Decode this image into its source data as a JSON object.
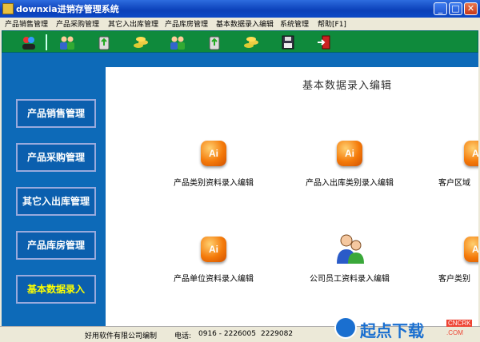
{
  "window": {
    "title": "downxia进销存管理系统"
  },
  "menu": [
    "产品销售管理",
    "产品采购管理",
    "其它入出库管理",
    "产品库房管理",
    "基本数据录入编辑",
    "系统管理",
    "帮助[F1]"
  ],
  "toolbar_icons": [
    "users-icon",
    "group-icon",
    "recycle-bin-icon",
    "coins-icon",
    "group-icon",
    "recycle-bin-icon",
    "coins-icon",
    "disk-icon",
    "exit-door-icon"
  ],
  "sidebar": [
    {
      "label": "产品销售管理",
      "active": false
    },
    {
      "label": "产品采购管理",
      "active": false
    },
    {
      "label": "其它入出库管理",
      "active": false
    },
    {
      "label": "产品库房管理",
      "active": false
    },
    {
      "label": "基本数据录入",
      "active": true
    }
  ],
  "content": {
    "heading": "基本数据录入编辑",
    "items": [
      {
        "label": "产品类别资料录入编辑",
        "icon": "ai-icon",
        "icon_text": "Ai"
      },
      {
        "label": "产品入出库类别录入编辑",
        "icon": "ai-icon",
        "icon_text": "Ai"
      },
      {
        "label": "客户区域",
        "icon": "ai-icon",
        "icon_text": "Ai"
      },
      {
        "label": "产品单位资料录入编辑",
        "icon": "ai-icon",
        "icon_text": "Ai"
      },
      {
        "label": "公司员工资料录入编辑",
        "icon": "people-icon",
        "icon_text": ""
      },
      {
        "label": "客户类别",
        "icon": "ai-icon",
        "icon_text": "Ai"
      }
    ]
  },
  "status": {
    "company": "好用软件有限公司编制",
    "phone_label": "电话:",
    "phone": "0916 - 2226005",
    "phone2": "2229082"
  },
  "watermark": {
    "text": "起点下载",
    "badge": "CNCRK",
    "domain": ".COM"
  },
  "colors": {
    "title_blue": "#0a3fb8",
    "toolbar_green": "#0f8a3c",
    "panel_blue": "#0d6ab8",
    "active_text": "#ffff00",
    "icon_orange": "#f47a0a"
  }
}
